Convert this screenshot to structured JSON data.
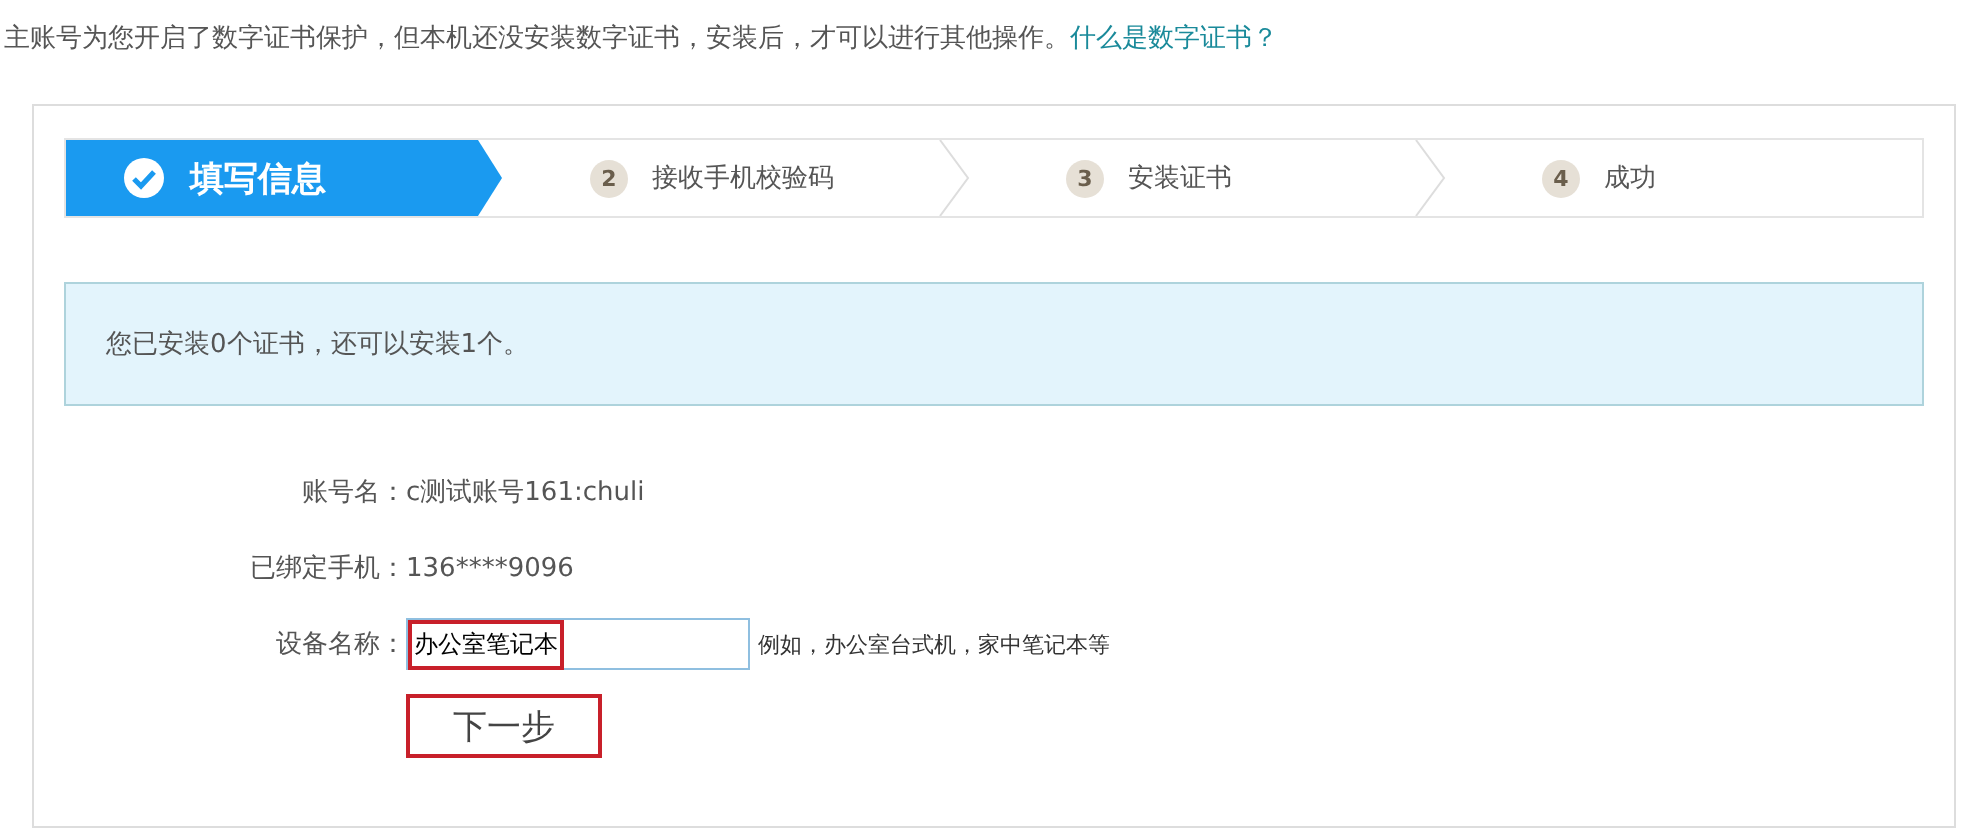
{
  "notice": {
    "text": "主账号为您开启了数字证书保护，但本机还没安装数字证书，安装后，才可以进行其他操作。",
    "link": "什么是数字证书？"
  },
  "steps": [
    {
      "label": "填写信息",
      "selected": true
    },
    {
      "number": "2",
      "label": "接收手机校验码",
      "selected": false
    },
    {
      "number": "3",
      "label": "安装证书",
      "selected": false
    },
    {
      "number": "4",
      "label": "成功",
      "selected": false
    }
  ],
  "info": "您已安装0个证书，还可以安装1个。",
  "form": [
    {
      "kind": "text",
      "label": "账号名：",
      "value": "c测试账号161:chuli"
    },
    {
      "kind": "text",
      "label": "已绑定手机：",
      "value": "136****9096"
    },
    {
      "kind": "input",
      "label": "设备名称：",
      "value": "办公室笔记本",
      "highlighted": true,
      "hint": "例如，办公室台式机，家中笔记本等"
    }
  ],
  "next_button": {
    "label": "下一步",
    "highlighted": true
  }
}
